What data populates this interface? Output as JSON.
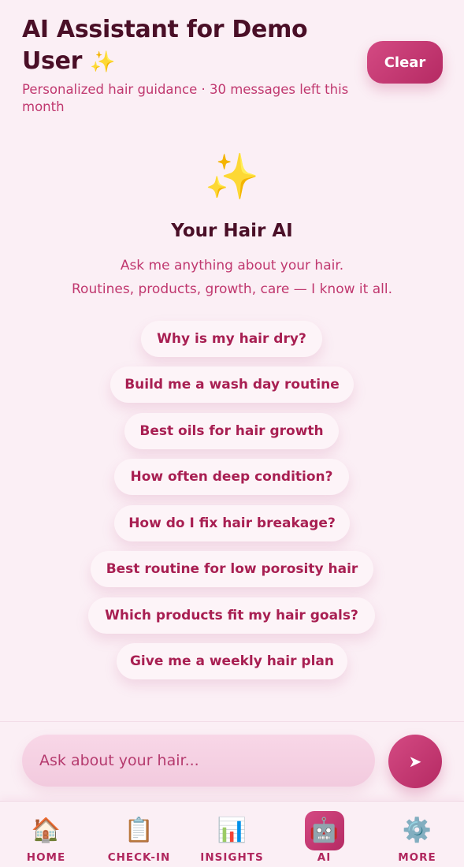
{
  "header": {
    "title": "AI Assistant for Demo User",
    "title_sparkle": "✨",
    "subtitle": "Personalized hair guidance · 30 messages left this month",
    "clear_label": "Clear"
  },
  "hero": {
    "icon": "sparkles-icon",
    "icon_glyph": "✨",
    "title": "Your Hair AI",
    "line1": "Ask me anything about your hair.",
    "line2": "Routines, products, growth, care — I know it all."
  },
  "suggestions": [
    "Why is my hair dry?",
    "Build me a wash day routine",
    "Best oils for hair growth",
    "How often deep condition?",
    "How do I fix hair breakage?",
    "Best routine for low porosity hair",
    "Which products fit my hair goals?",
    "Give me a weekly hair plan"
  ],
  "input": {
    "placeholder": "Ask about your hair...",
    "value": "",
    "send_icon": "send-arrow-icon",
    "send_glyph": "➤"
  },
  "nav": {
    "active": "AI",
    "items": [
      {
        "label": "HOME",
        "icon": "house-icon",
        "glyph": "🏠"
      },
      {
        "label": "CHECK-IN",
        "icon": "clipboard-icon",
        "glyph": "📋"
      },
      {
        "label": "INSIGHTS",
        "icon": "bar-chart-icon",
        "glyph": "📊"
      },
      {
        "label": "AI",
        "icon": "robot-icon",
        "glyph": "🤖"
      },
      {
        "label": "MORE",
        "icon": "gear-icon",
        "glyph": "⚙️"
      }
    ]
  },
  "colors": {
    "background": "#fbeff5",
    "accent": "#c2356f",
    "title_text": "#4a0f27",
    "secondary_text": "#c0386f"
  }
}
